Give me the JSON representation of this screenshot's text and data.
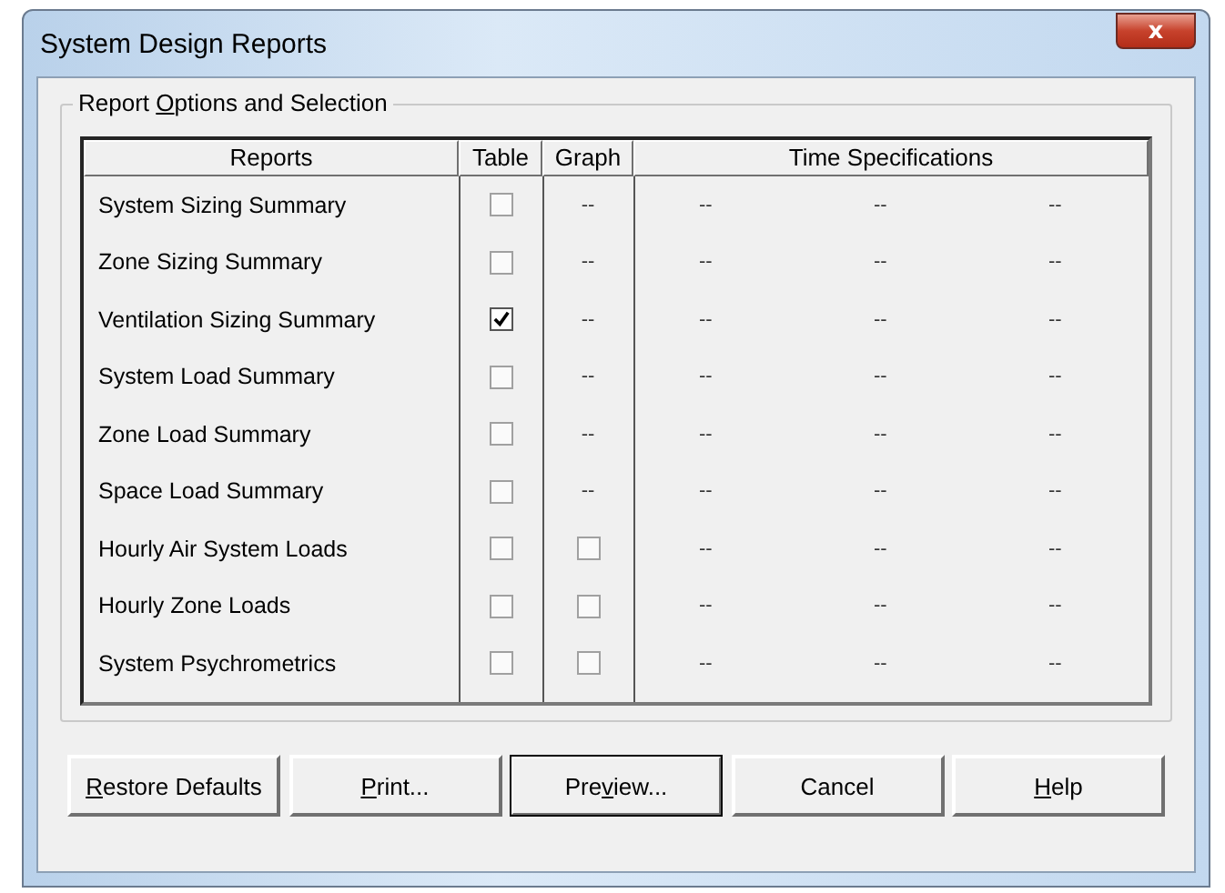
{
  "window": {
    "title": "System Design Reports",
    "close": "x"
  },
  "group": {
    "label_parts": [
      "Report ",
      "O",
      "ptions and Selection"
    ]
  },
  "table": {
    "columns": [
      "Reports",
      "Table",
      "Graph",
      "Time Specifications"
    ],
    "rows": [
      {
        "name": "System Sizing Summary",
        "table": {
          "kind": "checkbox",
          "checked": false
        },
        "graph": {
          "kind": "text",
          "text": "--"
        },
        "time": [
          "--",
          "--",
          "--"
        ]
      },
      {
        "name": "Zone Sizing Summary",
        "table": {
          "kind": "checkbox",
          "checked": false
        },
        "graph": {
          "kind": "text",
          "text": "--"
        },
        "time": [
          "--",
          "--",
          "--"
        ]
      },
      {
        "name": "Ventilation Sizing Summary",
        "table": {
          "kind": "checkbox",
          "checked": true
        },
        "graph": {
          "kind": "text",
          "text": "--"
        },
        "time": [
          "--",
          "--",
          "--"
        ]
      },
      {
        "name": "System Load Summary",
        "table": {
          "kind": "checkbox",
          "checked": false
        },
        "graph": {
          "kind": "text",
          "text": "--"
        },
        "time": [
          "--",
          "--",
          "--"
        ]
      },
      {
        "name": "Zone Load Summary",
        "table": {
          "kind": "checkbox",
          "checked": false
        },
        "graph": {
          "kind": "text",
          "text": "--"
        },
        "time": [
          "--",
          "--",
          "--"
        ]
      },
      {
        "name": "Space Load Summary",
        "table": {
          "kind": "checkbox",
          "checked": false
        },
        "graph": {
          "kind": "text",
          "text": "--"
        },
        "time": [
          "--",
          "--",
          "--"
        ]
      },
      {
        "name": "Hourly Air System Loads",
        "table": {
          "kind": "checkbox",
          "checked": false
        },
        "graph": {
          "kind": "checkbox",
          "checked": false
        },
        "time": [
          "--",
          "--",
          "--"
        ]
      },
      {
        "name": "Hourly Zone Loads",
        "table": {
          "kind": "checkbox",
          "checked": false
        },
        "graph": {
          "kind": "checkbox",
          "checked": false
        },
        "time": [
          "--",
          "--",
          "--"
        ]
      },
      {
        "name": "System Psychrometrics",
        "table": {
          "kind": "checkbox",
          "checked": false
        },
        "graph": {
          "kind": "checkbox",
          "checked": false
        },
        "time": [
          "--",
          "--",
          "--"
        ]
      }
    ]
  },
  "buttons": [
    {
      "key": "R",
      "after": "estore Defaults",
      "default": false
    },
    {
      "key": "P",
      "after": "rint...",
      "default": false
    },
    {
      "before": "Pre",
      "key": "v",
      "after": "iew...",
      "default": true
    },
    {
      "before": "Cancel",
      "default": false
    },
    {
      "key": "H",
      "after": "elp",
      "default": false
    }
  ]
}
